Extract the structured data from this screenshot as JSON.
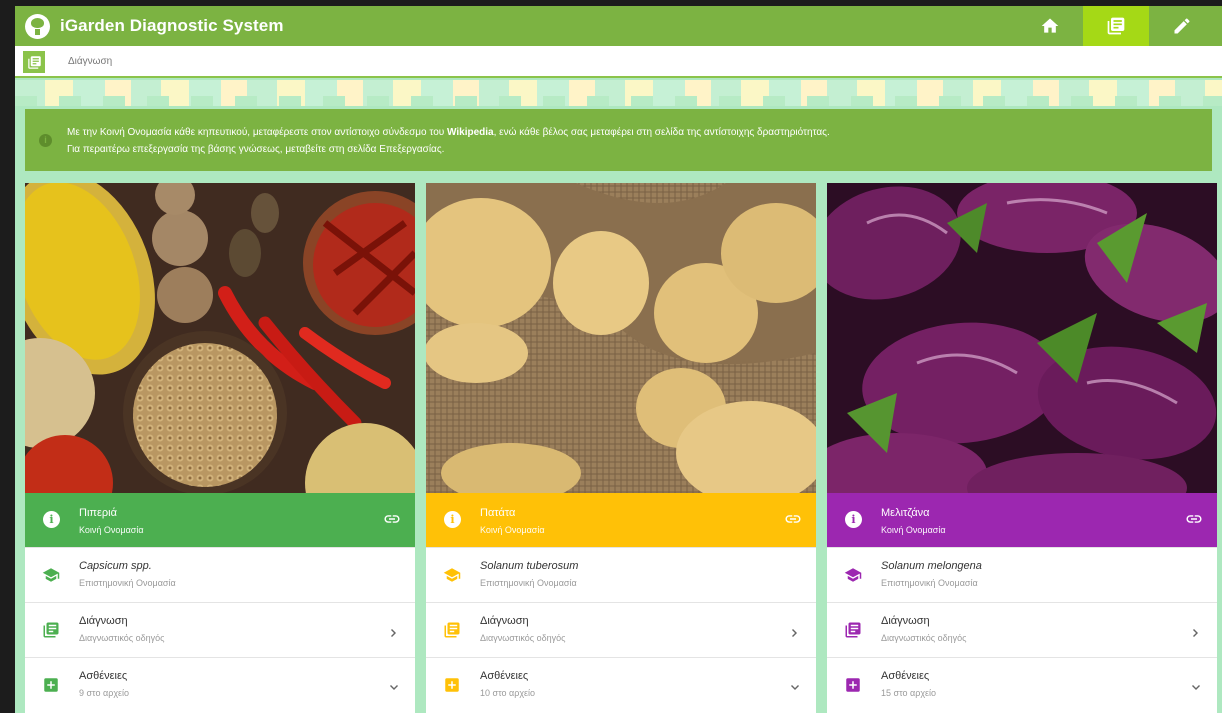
{
  "app": {
    "title": "iGarden Diagnostic System",
    "colors": {
      "primary": "#7cb342",
      "active_nav": "#a5d916"
    }
  },
  "nav": [
    {
      "name": "home",
      "icon": "home-icon",
      "active": false
    },
    {
      "name": "diagnosis",
      "icon": "library-books-icon",
      "active": true
    },
    {
      "name": "edit",
      "icon": "pencil-icon",
      "active": false
    }
  ],
  "breadcrumb": {
    "icon": "library-books-icon",
    "text": "Διάγνωση"
  },
  "info": {
    "icon": "info-icon",
    "line1_pre": "Με την Κοινή Ονομασία κάθε κηπευτικού, μεταφέρεστε στον αντίστοιχο σύνδεσμο του ",
    "line1_bold": "Wikipedia",
    "line1_post": ", ενώ κάθε βέλος σας μεταφέρει στη σελίδα της αντίστοιχης δραστηριότητας.",
    "line2": "Για περαιτέρω επεξεργασία της βάσης γνώσεως, μεταβείτε στη σελίδα Επεξεργασίας."
  },
  "cards": [
    {
      "color": "#4caf50",
      "common_name": "Πιπεριά",
      "common_label": "Κοινή Ονομασία",
      "scientific_name": "Capsicum spp.",
      "scientific_label": "Επιστημονική Ονομασία",
      "diagnosis_label": "Διάγνωση",
      "diagnosis_sub": "Διαγνωστικός οδηγός",
      "diseases_label": "Ασθένειες",
      "diseases_sub": "9 στο αρχείο"
    },
    {
      "color": "#ffc107",
      "common_name": "Πατάτα",
      "common_label": "Κοινή Ονομασία",
      "scientific_name": "Solanum tuberosum",
      "scientific_label": "Επιστημονική Ονομασία",
      "diagnosis_label": "Διάγνωση",
      "diagnosis_sub": "Διαγνωστικός οδηγός",
      "diseases_label": "Ασθένειες",
      "diseases_sub": "10 στο αρχείο"
    },
    {
      "color": "#9c27b0",
      "common_name": "Μελιτζάνα",
      "common_label": "Κοινή Ονομασία",
      "scientific_name": "Solanum melongena",
      "scientific_label": "Επιστημονική Ονομασία",
      "diagnosis_label": "Διάγνωση",
      "diagnosis_sub": "Διαγνωστικός οδηγός",
      "diseases_label": "Ασθένειες",
      "diseases_sub": "15 στο αρχείο"
    }
  ]
}
